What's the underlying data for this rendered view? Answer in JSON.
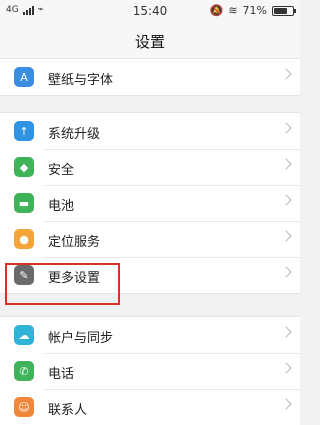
{
  "status_bar": {
    "network": "4G",
    "time": "15:40",
    "battery_percent_text": "71%",
    "battery_level": 0.71,
    "icons": [
      "signal-icon",
      "usb-icon",
      "mute-bell-icon",
      "wifi-icon",
      "battery-charging-icon"
    ]
  },
  "header": {
    "title": "设置"
  },
  "groups": [
    {
      "items": [
        {
          "label": "壁纸与字体",
          "icon": "wallpaper-font-icon",
          "color": "#3b8de0"
        }
      ]
    },
    {
      "items": [
        {
          "label": "系统升级",
          "icon": "system-update-icon",
          "color": "#2f93e3"
        },
        {
          "label": "安全",
          "icon": "security-shield-icon",
          "color": "#3fb35a"
        },
        {
          "label": "电池",
          "icon": "battery-icon",
          "color": "#3fb35a"
        },
        {
          "label": "定位服务",
          "icon": "location-icon",
          "color": "#f3a53a"
        },
        {
          "label": "更多设置",
          "icon": "wrench-icon",
          "color": "#6a6a6a"
        }
      ]
    },
    {
      "items": [
        {
          "label": "帐户与同步",
          "icon": "account-sync-icon",
          "color": "#2fb3d6"
        },
        {
          "label": "电话",
          "icon": "phone-icon",
          "color": "#3fb35a"
        },
        {
          "label": "联系人",
          "icon": "contacts-icon",
          "color": "#f0873a"
        }
      ]
    }
  ],
  "highlight": {
    "target": "更多设置",
    "color": "#d9302a"
  }
}
